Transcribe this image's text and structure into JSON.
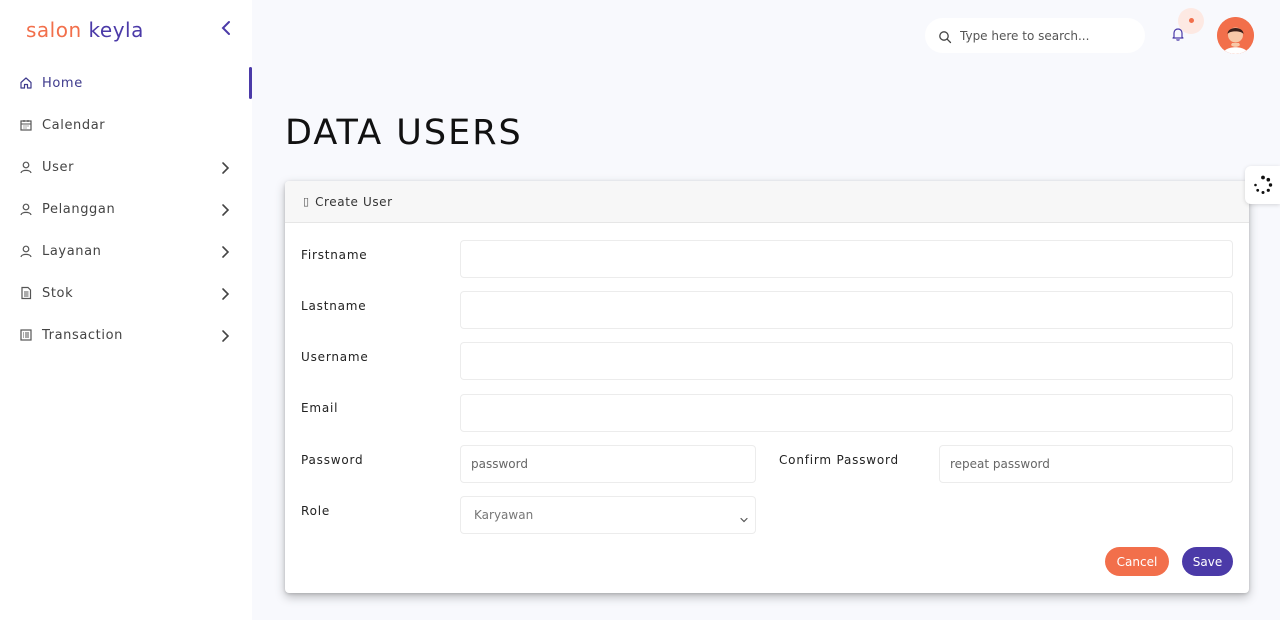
{
  "brand": {
    "part1": "salon",
    "part2": "keyla"
  },
  "sidebar": {
    "items": [
      {
        "label": "Home",
        "icon": "home-icon"
      },
      {
        "label": "Calendar",
        "icon": "calendar-icon"
      },
      {
        "label": "User",
        "icon": "user-icon"
      },
      {
        "label": "Pelanggan",
        "icon": "user-icon"
      },
      {
        "label": "Layanan",
        "icon": "user-icon"
      },
      {
        "label": "Stok",
        "icon": "document-icon"
      },
      {
        "label": "Transaction",
        "icon": "list-icon"
      }
    ]
  },
  "header": {
    "search_placeholder": "Type here to search..."
  },
  "page": {
    "title": "DATA USERS"
  },
  "card": {
    "title": "Create User",
    "fields": {
      "firstname": "Firstname",
      "lastname": "Lastname",
      "username": "Username",
      "email": "Email",
      "password": "Password",
      "password_placeholder": "password",
      "confirm_password": "Confirm Password",
      "confirm_placeholder": "repeat password",
      "role": "Role",
      "role_value": "Karyawan"
    },
    "cancel_label": "Cancel",
    "save_label": "Save"
  },
  "colors": {
    "accent": "#4b3aa8",
    "orange": "#f26f4b"
  }
}
